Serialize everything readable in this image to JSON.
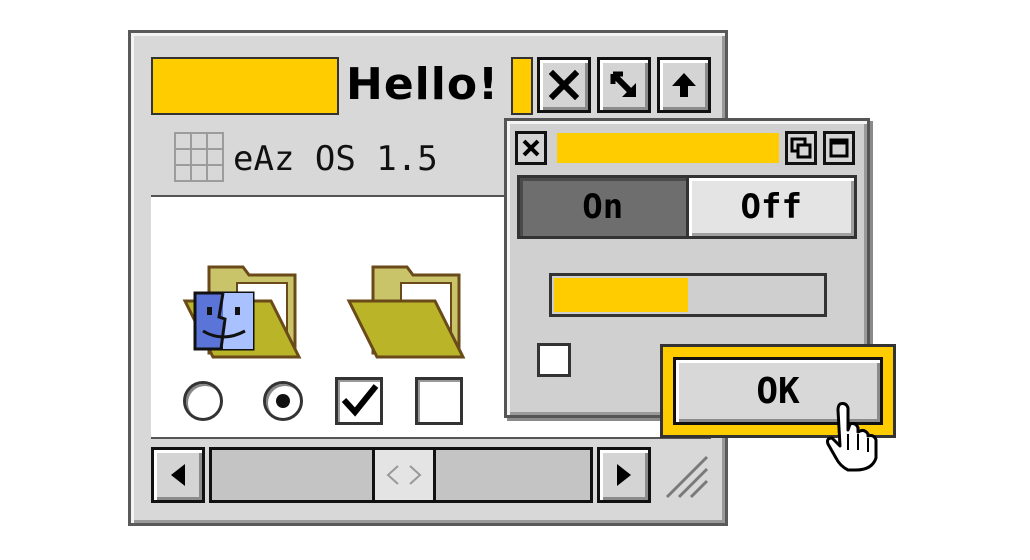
{
  "main_window": {
    "title": "Hello!",
    "os_label": "eAz OS 1.5",
    "titlebar_buttons": [
      "close-icon",
      "zoom-icon",
      "collapse-icon"
    ],
    "icons": [
      "finder-folder-icon",
      "folder-icon"
    ],
    "radios": [
      {
        "selected": false
      },
      {
        "selected": true
      }
    ],
    "checkboxes": [
      {
        "checked": true
      },
      {
        "checked": false
      }
    ]
  },
  "dialog": {
    "segmented": {
      "on_label": "On",
      "off_label": "Off",
      "selected": "On"
    },
    "progress": 0.5,
    "checkbox_checked": false,
    "ok_label": "OK"
  },
  "colors": {
    "accent": "#ffcc00",
    "window_bg": "#d8d8d8",
    "selected_segment": "#6e6e6e"
  }
}
